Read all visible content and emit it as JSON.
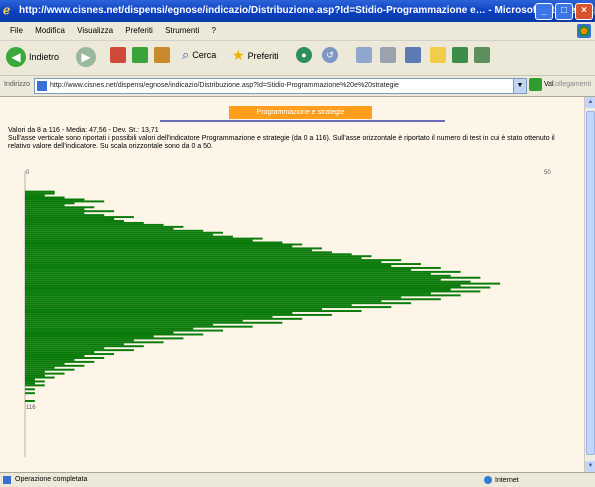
{
  "window": {
    "title": "http://www.cisnes.net/dispensi/egnose/indicazio/Distribuzione.asp?Id=Stidio-Programmazione e… - Microsoft Internet Explorer",
    "controls": {
      "minimize": "_",
      "maximize": "□",
      "close": "×"
    }
  },
  "menu": [
    "File",
    "Modifica",
    "Visualizza",
    "Preferiti",
    "Strumenti",
    "?"
  ],
  "toolbar": {
    "back": "Indietro",
    "search": "Cerca",
    "favorites": "Preferiti"
  },
  "address": {
    "label": "Indirizzo",
    "value": "http://www.cisnes.net/dispensi/egnose/indicazio/Distribuzione.asp?Id=Stidio-Programmazione%20e%20strategie",
    "go_label": "Vai",
    "links_label": "Collegamenti"
  },
  "page": {
    "tab_label": "Programmazione e strategie",
    "stats_line": "Valori da 8 a 116 - Media: 47,56 - Dev. St.: 13,71",
    "description": "Sull'asse verticale sono riportati i possibili valori dell'indicatore Programmazione e strategie (da 0 a 116). Sull'asse orizzontale è riportato il numero di test in cui è stato ottenuto il relativo valore dell'indicatore. Su scala orizzontale sono da 0 a 50.",
    "axis_top_label": "0",
    "axis_bottom_label": "116",
    "corner_label": "50"
  },
  "status": {
    "text": "Operazione completata",
    "zone": "Internet"
  },
  "colors": {
    "bar": "#0a7a0a",
    "tab": "#ff9d1c",
    "title_bar": "#0a3fbf",
    "page_background": "#fdf6e8"
  },
  "chart_data": {
    "type": "bar",
    "orientation": "horizontal",
    "y_range": [
      0,
      116
    ],
    "x_range": [
      0,
      50
    ],
    "bar_color": "#0a7a0a",
    "values": [
      0,
      0,
      0,
      0,
      0,
      0,
      0,
      0,
      3,
      3,
      2,
      4,
      6,
      8,
      5,
      4,
      7,
      6,
      9,
      6,
      8,
      11,
      9,
      10,
      12,
      14,
      16,
      15,
      18,
      20,
      19,
      21,
      24,
      23,
      26,
      28,
      27,
      30,
      29,
      31,
      33,
      35,
      34,
      38,
      36,
      40,
      37,
      42,
      39,
      44,
      41,
      43,
      46,
      42,
      45,
      48,
      44,
      47,
      43,
      46,
      41,
      44,
      38,
      42,
      36,
      39,
      33,
      37,
      30,
      34,
      27,
      31,
      25,
      28,
      22,
      26,
      19,
      23,
      17,
      20,
      15,
      18,
      13,
      16,
      11,
      14,
      10,
      12,
      8,
      11,
      7,
      9,
      6,
      8,
      5,
      7,
      4,
      6,
      3,
      5,
      2,
      4,
      2,
      3,
      1,
      2,
      1,
      2,
      0,
      1,
      0,
      1,
      0,
      0,
      0,
      1
    ]
  }
}
